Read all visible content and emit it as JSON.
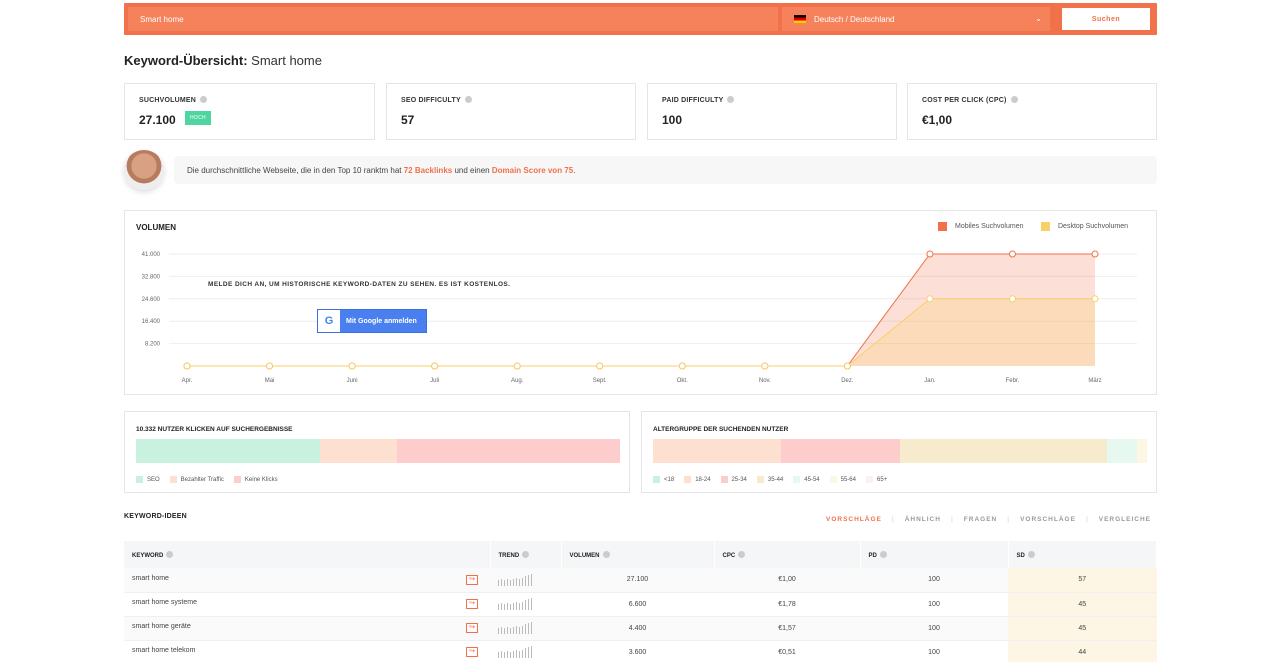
{
  "search": {
    "value": "Smart home",
    "language": "Deutsch / Deutschland",
    "button_label": "Suchen"
  },
  "page": {
    "title_bold": "Keyword-Übersicht:",
    "title_keyword": "Smart home"
  },
  "metrics": [
    {
      "label": "SUCHVOLUMEN",
      "value": "27.100",
      "badge": "HOCH"
    },
    {
      "label": "SEO DIFFICULTY",
      "value": "57"
    },
    {
      "label": "PAID DIFFICULTY",
      "value": "100"
    },
    {
      "label": "COST PER CLICK (CPC)",
      "value": "€1,00"
    }
  ],
  "banner": {
    "text_before": "Die durchschnittliche Webseite, die in den Top 10 ranktm hat ",
    "backlinks": "72 Backlinks",
    "text_mid": " und einen ",
    "domain_score": "Domain Score von 75",
    "text_after": "."
  },
  "volume": {
    "title": "VOLUMEN",
    "legend_mobile": "Mobiles Suchvolumen",
    "legend_desktop": "Desktop Suchvolumen",
    "message": "MELDE DICH AN, UM HISTORISCHE KEYWORD-DATEN ZU SEHEN. ES IST KOSTENLOS.",
    "google_button": "Mit Google anmelden"
  },
  "colors": {
    "accent": "#f0714a",
    "mobile": "#f0714a",
    "desktop": "#f9cf6a"
  },
  "chart_data": {
    "type": "area",
    "x": [
      "Apr.",
      "Mai",
      "Juni",
      "Juli",
      "Aug.",
      "Sept.",
      "Okt.",
      "Nov.",
      "Dez.",
      "Jan.",
      "Febr.",
      "März"
    ],
    "series": [
      {
        "name": "Mobiles Suchvolumen",
        "values": [
          0,
          0,
          0,
          0,
          0,
          0,
          0,
          0,
          0,
          41000,
          41000,
          41000
        ]
      },
      {
        "name": "Desktop Suchvolumen",
        "values": [
          0,
          0,
          0,
          0,
          0,
          0,
          0,
          0,
          0,
          24600,
          24600,
          24600
        ]
      }
    ],
    "y_ticks": [
      "41.000",
      "32.800",
      "24.600",
      "16.400",
      "8.200"
    ],
    "ylim": [
      0,
      41000
    ],
    "grid": true,
    "legend": "top-right"
  },
  "clicks": {
    "title": "10.332 NUTZER KLICKEN AUF SUCHERGEBNISSE",
    "segments": [
      {
        "name": "SEO",
        "share": 0.38,
        "color": "#c9f1e0"
      },
      {
        "name": "Bezahlter Traffic",
        "share": 0.16,
        "color": "#fde0cf"
      },
      {
        "name": "Keine Klicks",
        "share": 0.46,
        "color": "#fdcccc"
      }
    ]
  },
  "age": {
    "title": "ALTERGRUPPE DER SUCHENDEN NUTZER",
    "segments": [
      {
        "name": "<18",
        "share": 0.0,
        "color": "#c9f1e0"
      },
      {
        "name": "18-24",
        "share": 0.26,
        "color": "#fde0cf"
      },
      {
        "name": "25-34",
        "share": 0.24,
        "color": "#fdcccc"
      },
      {
        "name": "35-44",
        "share": 0.42,
        "color": "#f6ebcc"
      },
      {
        "name": "45-54",
        "share": 0.06,
        "color": "#e6f8ef"
      },
      {
        "name": "55-64",
        "share": 0.02,
        "color": "#fdf6e3"
      },
      {
        "name": "65+",
        "share": 0.0,
        "color": "#fdeef0"
      }
    ]
  },
  "keywords": {
    "title": "KEYWORD-IDEEN",
    "tabs": [
      "VORSCHLÄGE",
      "ÄHNLICH",
      "FRAGEN",
      "VORSCHLÄGE",
      "VERGLEICHE"
    ],
    "columns": [
      "KEYWORD",
      "TREND",
      "VOLUMEN",
      "CPC",
      "PD",
      "SD"
    ],
    "rows": [
      {
        "keyword": "smart home",
        "volume": "27.100",
        "cpc": "€1,00",
        "pd": "100",
        "sd": "57"
      },
      {
        "keyword": "smart home systeme",
        "volume": "6.600",
        "cpc": "€1,78",
        "pd": "100",
        "sd": "45"
      },
      {
        "keyword": "smart home geräte",
        "volume": "4.400",
        "cpc": "€1,57",
        "pd": "100",
        "sd": "45"
      },
      {
        "keyword": "smart home telekom",
        "volume": "3.600",
        "cpc": "€0,51",
        "pd": "100",
        "sd": "44"
      }
    ]
  }
}
